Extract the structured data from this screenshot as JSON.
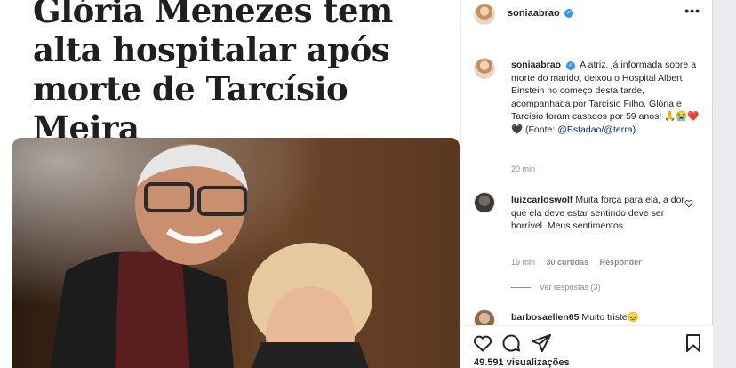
{
  "media": {
    "headline": "Glória Menezes tem alta hospitalar após morte de Tarcísio Meira"
  },
  "header": {
    "username": "soniaabrao",
    "verified": "✓",
    "more": "•••"
  },
  "caption": {
    "username": "soniaabrao",
    "verified": "✓",
    "text": "A atriz, já informada sobre a morte do marido, deixou o Hospital Albert Einstein no começo desta tarde, acompanhada por Tarcísio Filho. Glória e Tarcísio foram casados por 59 anos! 🙏😭❤️🖤 (Fonte:",
    "mention1": "@Estadao",
    "separator": "/",
    "mention2": "@terra",
    "close": ")",
    "time": "20 min"
  },
  "comments": [
    {
      "username": "luizcarloswolf",
      "text": "Muita força para ela, a dor que ela deve estar sentindo deve ser horrível. Meus sentimentos",
      "time": "19 min",
      "likes": "30 curtidas",
      "reply": "Responder",
      "view_replies": "Ver respostas (3)"
    },
    {
      "username": "barbosaellen65",
      "text": "Muito triste😞"
    }
  ],
  "footer": {
    "views": "49.591 visualizações"
  },
  "icons": [
    "like-icon",
    "comment-icon",
    "share-icon",
    "save-icon",
    "heart-small-icon"
  ],
  "colors": {
    "link": "#00376b",
    "verified": "#3897f0",
    "muted": "#8e8e8e"
  }
}
